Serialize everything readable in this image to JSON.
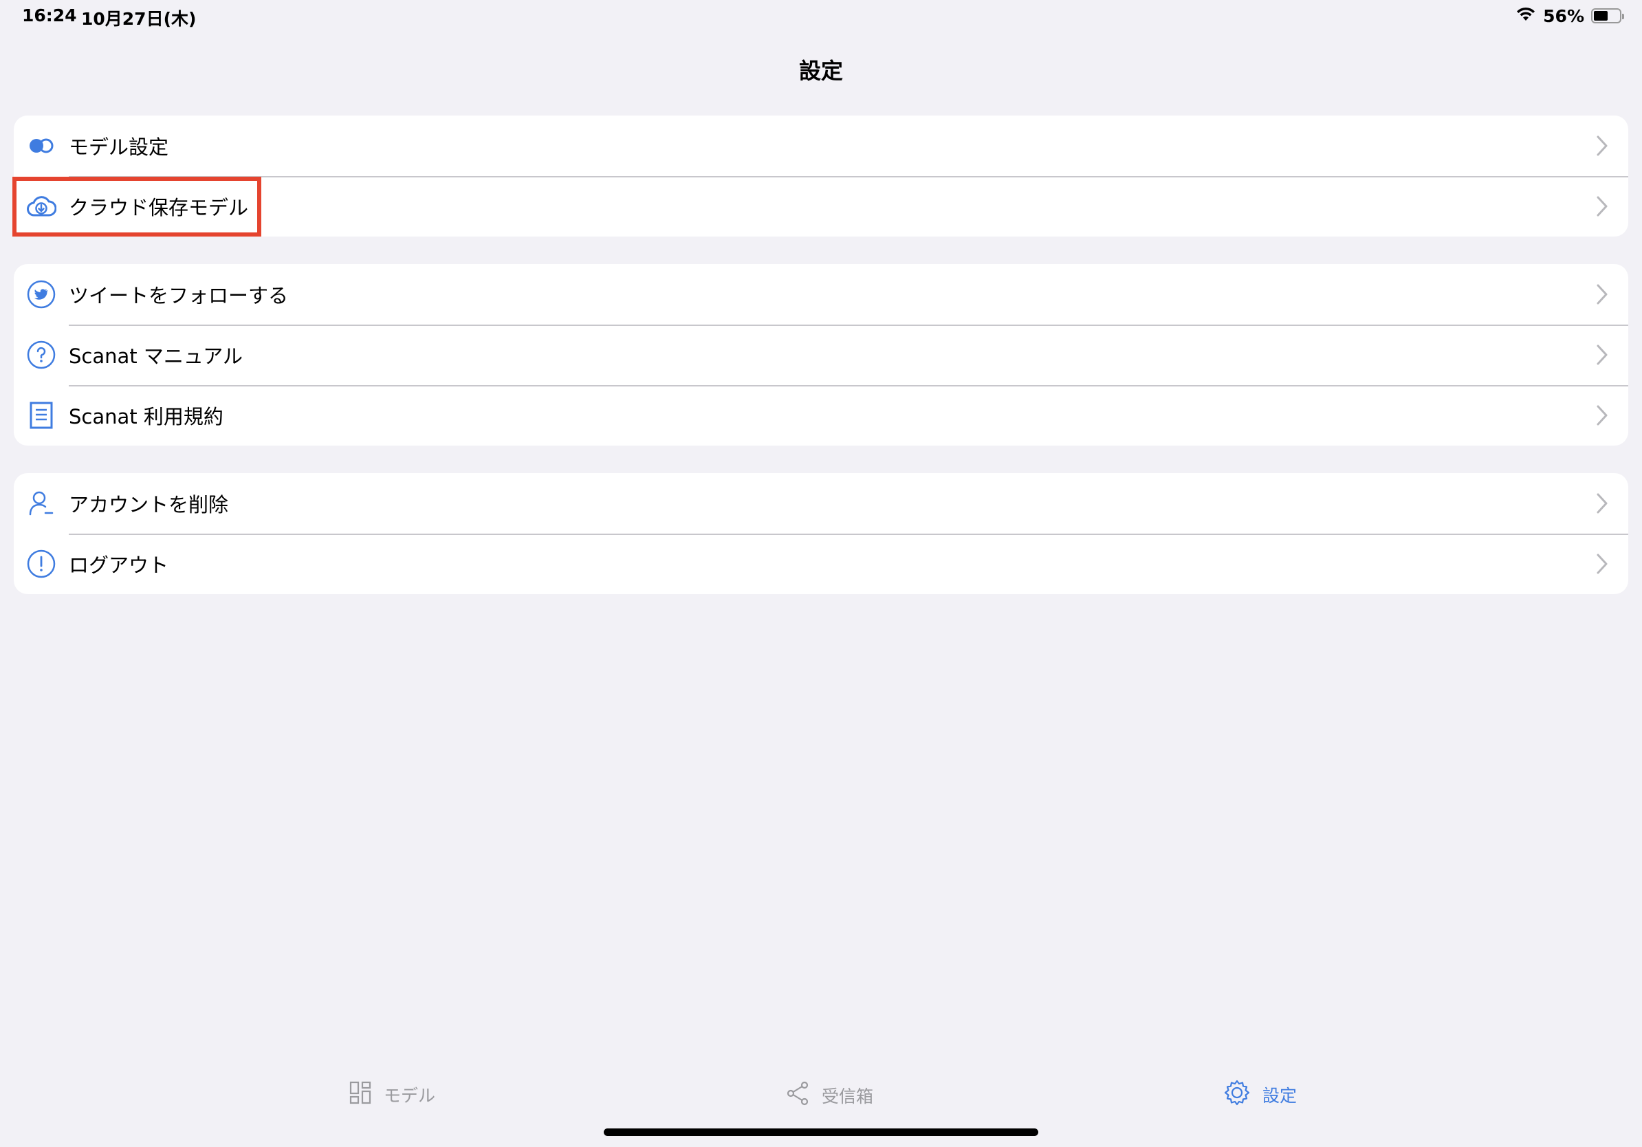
{
  "status_bar": {
    "time": "16:24",
    "date": "10月27日(木)",
    "battery_percent": "56%",
    "battery_level": 0.56
  },
  "nav": {
    "title": "設定"
  },
  "groups": [
    {
      "items": [
        {
          "label": "モデル設定",
          "icon": "toggle-icon"
        },
        {
          "label": "クラウド保存モデル",
          "icon": "cloud-download-icon"
        }
      ]
    },
    {
      "items": [
        {
          "label": "ツイートをフォローする",
          "icon": "twitter-icon"
        },
        {
          "label": "Scanat マニュアル",
          "icon": "help-circle-icon"
        },
        {
          "label": "Scanat 利用規約",
          "icon": "document-icon"
        }
      ]
    },
    {
      "items": [
        {
          "label": "アカウントを削除",
          "icon": "person-remove-icon"
        },
        {
          "label": "ログアウト",
          "icon": "alert-circle-icon"
        }
      ]
    }
  ],
  "tabs": [
    {
      "label": "モデル",
      "icon": "grid-icon",
      "active": false
    },
    {
      "label": "受信箱",
      "icon": "share-icon",
      "active": false
    },
    {
      "label": "設定",
      "icon": "gear-icon",
      "active": true
    }
  ],
  "colors": {
    "accent": "#3f7ce0",
    "highlight": "#e5442f",
    "background": "#f2f1f6",
    "inactive_tab": "#9a9a9e"
  }
}
